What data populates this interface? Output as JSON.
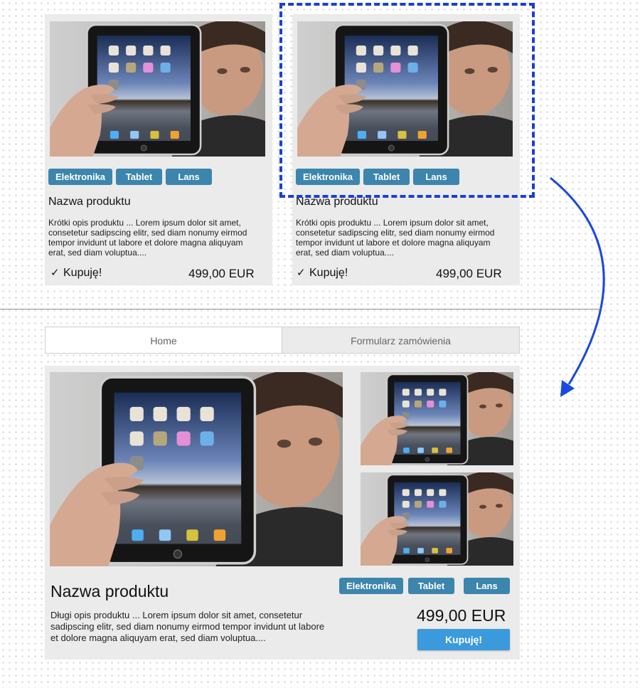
{
  "tags": [
    "Elektronika",
    "Tablet",
    "Lans"
  ],
  "list_cards": [
    {
      "title": "Nazwa produktu",
      "description": "Krótki opis produktu ... Lorem ipsum dolor sit amet, consetetur sadipscing elitr, sed diam nonumy eirmod tempor invidunt ut labore et dolore magna aliquyam erat, sed diam voluptua....",
      "buy_label": "Kupuję!",
      "check_icon": "✓",
      "price": "499,00 EUR"
    },
    {
      "title": "Nazwa produktu",
      "description": "Krótki opis produktu ... Lorem ipsum dolor sit amet, consetetur sadipscing elitr, sed diam nonumy eirmod tempor invidunt ut labore et dolore magna aliquyam erat, sed diam voluptua....",
      "buy_label": "Kupuję!",
      "check_icon": "✓",
      "price": "499,00 EUR"
    }
  ],
  "nav": {
    "home": "Home",
    "order_form": "Formularz zamówienia"
  },
  "detail": {
    "title": "Nazwa produktu",
    "description": "Długi opis produktu ... Lorem ipsum dolor sit amet, consetetur sadipscing elitr, sed diam nonumy eirmod tempor invidunt ut labore et dolore magna aliquyam erat, sed diam voluptua....",
    "price": "499,00 EUR",
    "buy_button": "Kupuję!"
  },
  "colors": {
    "tag": "#3c85ad",
    "buy_button": "#3a9adb",
    "highlight": "#1b3fd3",
    "card_bg": "#ebebeb"
  },
  "icons": [
    "check-icon",
    "curved-arrow-icon"
  ]
}
